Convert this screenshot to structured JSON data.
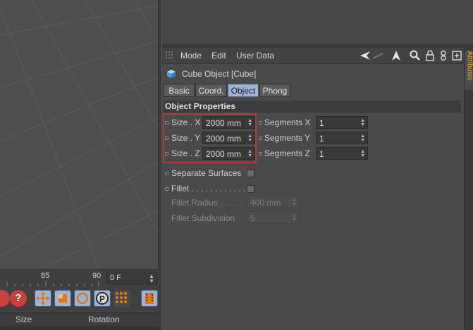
{
  "timeline": {
    "ticks": [
      "85",
      "90"
    ],
    "frame_value": "0 F"
  },
  "coord_header": {
    "size": "Size",
    "rotation": "Rotation"
  },
  "attributes": {
    "menu": {
      "mode": "Mode",
      "edit": "Edit",
      "user_data": "User Data"
    },
    "object_title": "Cube Object [Cube]",
    "tabs": [
      {
        "label": "Basic",
        "active": false
      },
      {
        "label": "Coord.",
        "active": false
      },
      {
        "label": "Object",
        "active": true
      },
      {
        "label": "Phong",
        "active": false
      }
    ],
    "section_header": "Object Properties",
    "size_x": {
      "label": "Size . X",
      "value": "2000 mm"
    },
    "size_y": {
      "label": "Size . Y",
      "value": "2000 mm"
    },
    "size_z": {
      "label": "Size . Z",
      "value": "2000 mm"
    },
    "seg_x": {
      "label": "Segments X",
      "value": "1"
    },
    "seg_y": {
      "label": "Segments Y",
      "value": "1"
    },
    "seg_z": {
      "label": "Segments Z",
      "value": "1"
    },
    "separate_surfaces": {
      "label": "Separate Surfaces",
      "checked": false
    },
    "fillet": {
      "label": "Fillet . . . . . . . . . . . .",
      "checked": false
    },
    "fillet_radius": {
      "label": "Fillet Radius . . . . .",
      "value": "400 mm"
    },
    "fillet_subdivision": {
      "label": "Fillet Subdivision",
      "value": "5"
    }
  },
  "side_tab": {
    "label": "Attributes"
  },
  "colors": {
    "active_tab": "#9cb4d8",
    "highlight": "#b33a3a",
    "side_tab_text": "#e8a93a"
  },
  "icons": {
    "toolbar_right": [
      "arrow-back-icon",
      "arrow-forward-icon",
      "arrow-up-icon",
      "search-icon",
      "lock-icon",
      "link-icon",
      "new-window-icon"
    ],
    "tools": [
      "help-icon",
      "move-icon",
      "scale-icon",
      "rotate-icon",
      "points-icon",
      "grid-icon",
      "film-icon"
    ]
  }
}
